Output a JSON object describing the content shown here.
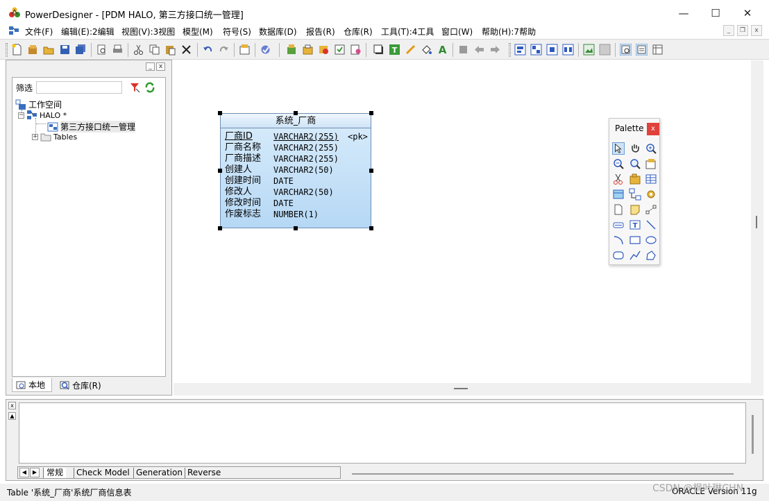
{
  "window": {
    "title": "PowerDesigner - [PDM HALO, 第三方接口统一管理]",
    "minimize_glyph": "—",
    "maximize_glyph": "☐",
    "close_glyph": "✕"
  },
  "menu": {
    "items": [
      "文件(F)",
      "编辑(E):2编辑",
      "视图(V):3视图",
      "模型(M)",
      "符号(S)",
      "数据库(D)",
      "报告(R)",
      "仓库(R)",
      "工具(T):4工具",
      "窗口(W)",
      "帮助(H):7帮助"
    ],
    "mdi_minimize": "_",
    "mdi_restore": "❐",
    "mdi_close": "x"
  },
  "browser": {
    "filter_label": "筛选",
    "filter_value": "",
    "tree": {
      "root": "工作空间",
      "model": "HALO *",
      "diagram": "第三方接口统一管理",
      "folder": "Tables"
    },
    "tabs": [
      "本地",
      "仓库(R)"
    ],
    "expander_minus": "−",
    "expander_plus": "+"
  },
  "entity": {
    "title": "系统_厂商",
    "columns": [
      {
        "name": "厂商ID",
        "type": "VARCHAR2(255)",
        "key": "<pk>"
      },
      {
        "name": "厂商名称",
        "type": "VARCHAR2(255)",
        "key": ""
      },
      {
        "name": "厂商描述",
        "type": "VARCHAR2(255)",
        "key": ""
      },
      {
        "name": "创建人",
        "type": "VARCHAR2(50)",
        "key": ""
      },
      {
        "name": "创建时间",
        "type": "DATE",
        "key": ""
      },
      {
        "name": "修改人",
        "type": "VARCHAR2(50)",
        "key": ""
      },
      {
        "name": "修改时间",
        "type": "DATE",
        "key": ""
      },
      {
        "name": "作废标志",
        "type": "NUMBER(1)",
        "key": ""
      }
    ]
  },
  "palette": {
    "title": "Palette",
    "close": "x",
    "tools": [
      "pointer-icon",
      "grabber-icon",
      "zoom-in-icon",
      "zoom-out-icon",
      "open-package-icon",
      "properties-icon",
      "delete-icon",
      "package-icon",
      "table-icon",
      "view-icon",
      "reference-icon",
      "procedure-icon",
      "file-icon",
      "note-icon",
      "link-icon",
      "title-icon",
      "text-icon",
      "line-icon",
      "arc-icon",
      "rectangle-icon",
      "ellipse-icon",
      "rounded-rect-icon",
      "polyline-icon",
      "polygon-icon"
    ]
  },
  "output": {
    "tabs": [
      "常规",
      "Check Model",
      "Generation",
      "Reverse"
    ],
    "close": "x",
    "scroll_up": "▲"
  },
  "status": {
    "left": "Table '系统_厂商'系统厂商信息表",
    "right": "ORACLE Version 11g",
    "watermark": "CSDN @枫叶琳CHN"
  },
  "colors": {
    "entity_fill": "#c4e0f8",
    "entity_border": "#6e8fb0",
    "palette_close": "#e0413a",
    "chrome": "#f0f0f0"
  }
}
